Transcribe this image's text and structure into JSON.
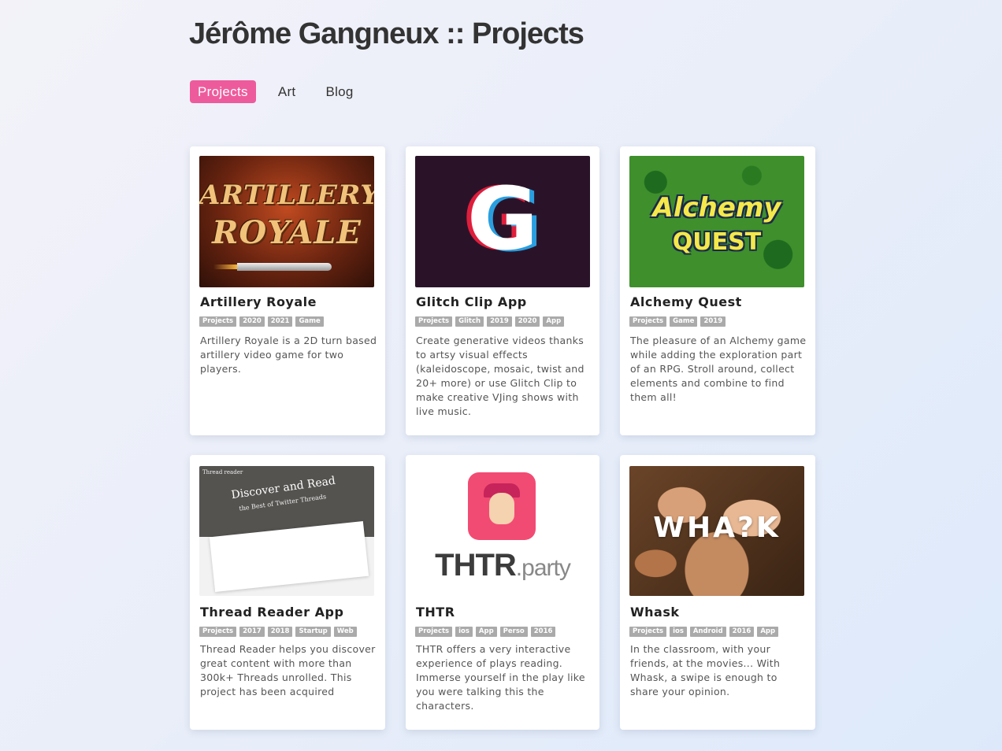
{
  "header": {
    "title": "Jérôme Gangneux :: Projects"
  },
  "nav": {
    "items": [
      "Projects",
      "Art",
      "Blog"
    ],
    "active": "Projects",
    "accent": "#ee5b9c"
  },
  "projects": [
    {
      "title": "Artillery Royale",
      "tags": [
        "Projects",
        "2020",
        "2021",
        "Game"
      ],
      "description": "Artillery Royale is a 2D turn based artillery video game for two players.",
      "thumb": {
        "line1": "ARTILLERY",
        "line2": "ROYALE"
      }
    },
    {
      "title": "Glitch Clip App",
      "tags": [
        "Projects",
        "Glitch",
        "2019",
        "2020",
        "App"
      ],
      "description": "Create generative videos thanks to artsy visual effects (kaleidoscope, mosaic, twist and 20+ more) or use Glitch Clip to make creative VJing shows with live music.",
      "thumb": {
        "letter": "G"
      }
    },
    {
      "title": "Alchemy Quest",
      "tags": [
        "Projects",
        "Game",
        "2019"
      ],
      "description": "The pleasure of an Alchemy game while adding the exploration part of an RPG. Stroll around, collect elements and combine to find them all!",
      "thumb": {
        "line1": "Alchemy",
        "line2": "QUEST"
      }
    },
    {
      "title": "Thread Reader App",
      "tags": [
        "Projects",
        "2017",
        "2018",
        "Startup",
        "Web"
      ],
      "description": "Thread Reader helps you discover great content with more than 300k+ Threads unrolled. This project has been acquired",
      "thumb": {
        "corner": "Thread reader",
        "headline": "Discover and Read",
        "sub": "the Best of Twitter Threads"
      }
    },
    {
      "title": "THTR",
      "tags": [
        "Projects",
        "ios",
        "App",
        "Perso",
        "2016"
      ],
      "description": "THTR offers a very interactive experience of plays reading. Immerse yourself in the play like you were talking this the characters.",
      "thumb": {
        "word": "THTR",
        "suffix": ".party"
      }
    },
    {
      "title": "Whask",
      "tags": [
        "Projects",
        "ios",
        "Android",
        "2016",
        "App"
      ],
      "description": "In the classroom, with your friends, at the movies... With Whask, a swipe is enough to share your opinion.",
      "thumb": {
        "word": "WHA?K"
      }
    }
  ]
}
